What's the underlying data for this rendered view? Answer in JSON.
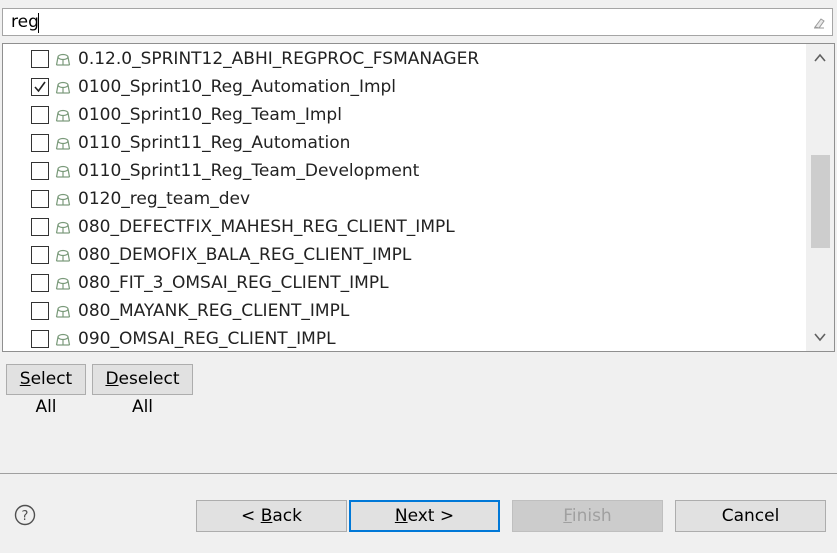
{
  "search": {
    "value": "reg",
    "clear_icon": "clear-filter-icon"
  },
  "list": {
    "item_icon": "repository-stream-icon",
    "items": [
      {
        "label": "0.12.0_SPRINT12_ABHI_REGPROC_FSMANAGER",
        "checked": false
      },
      {
        "label": "0100_Sprint10_Reg_Automation_Impl",
        "checked": true
      },
      {
        "label": "0100_Sprint10_Reg_Team_Impl",
        "checked": false
      },
      {
        "label": "0110_Sprint11_Reg_Automation",
        "checked": false
      },
      {
        "label": "0110_Sprint11_Reg_Team_Development",
        "checked": false
      },
      {
        "label": "0120_reg_team_dev",
        "checked": false
      },
      {
        "label": "080_DEFECTFIX_MAHESH_REG_CLIENT_IMPL",
        "checked": false
      },
      {
        "label": "080_DEMOFIX_BALA_REG_CLIENT_IMPL",
        "checked": false
      },
      {
        "label": "080_FIT_3_OMSAI_REG_CLIENT_IMPL",
        "checked": false
      },
      {
        "label": "080_MAYANK_REG_CLIENT_IMPL",
        "checked": false
      },
      {
        "label": "090_OMSAI_REG_CLIENT_IMPL",
        "checked": false
      }
    ]
  },
  "selection_buttons": {
    "select_all": {
      "mnemonic": "S",
      "rest": "elect All"
    },
    "deselect_all": {
      "mnemonic": "D",
      "rest": "eselect All"
    }
  },
  "wizard_buttons": {
    "back": {
      "prefix": "< ",
      "mnemonic": "B",
      "rest": "ack"
    },
    "next": {
      "mnemonic": "N",
      "rest": "ext >"
    },
    "finish": {
      "mnemonic": "F",
      "rest": "inish",
      "enabled": false
    },
    "cancel": {
      "label": "Cancel"
    }
  },
  "colors": {
    "default_button_border": "#0078d7",
    "disabled_text": "#a0a0a0"
  }
}
